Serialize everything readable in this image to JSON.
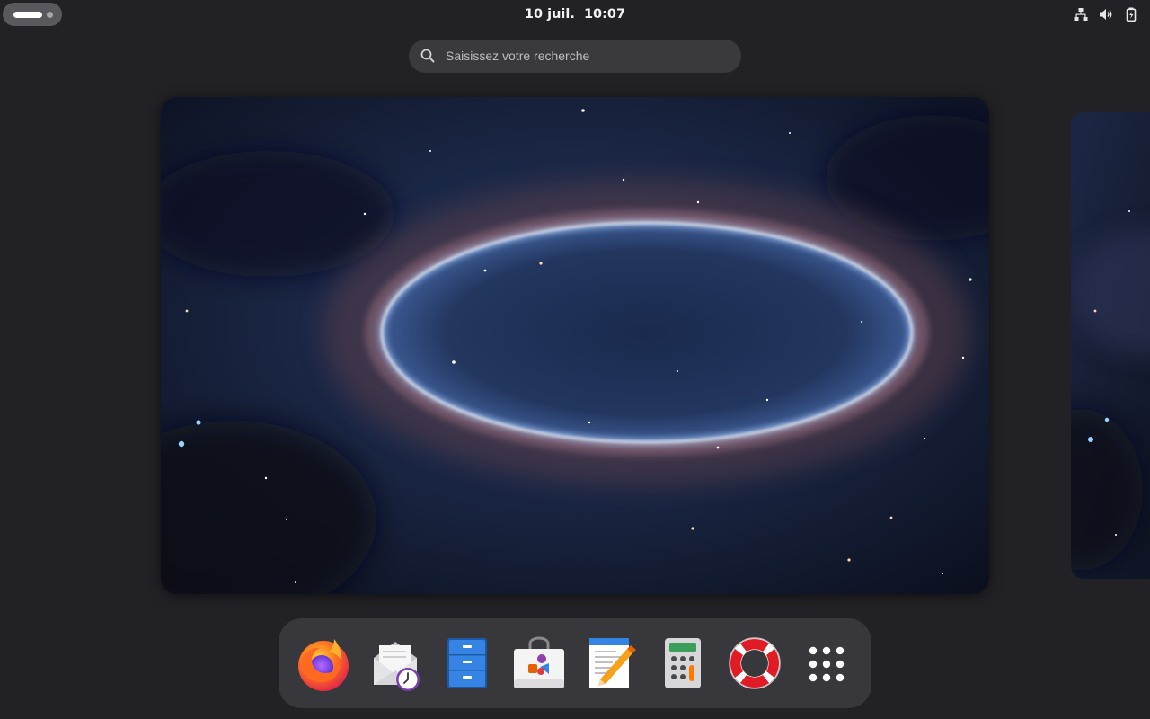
{
  "topbar": {
    "clock": "10 juil.  10:07",
    "tray_icons": [
      "network-wired-icon",
      "volume-icon",
      "battery-charging-icon"
    ]
  },
  "search": {
    "placeholder": "Saisissez votre recherche",
    "icon": "search-icon"
  },
  "workspaces": {
    "current": "workspace-1",
    "count_visible": 2,
    "wallpaper": "space-ring-nebula"
  },
  "dash": {
    "apps": [
      {
        "name": "Firefox",
        "icon": "firefox-icon"
      },
      {
        "name": "Evolution",
        "icon": "mail-clock-icon"
      },
      {
        "name": "Fichiers",
        "icon": "file-cabinet-icon"
      },
      {
        "name": "Logiciels",
        "icon": "software-bag-icon"
      },
      {
        "name": "Éditeur de texte",
        "icon": "text-editor-icon"
      },
      {
        "name": "Calculatrice",
        "icon": "calculator-icon"
      },
      {
        "name": "Aide",
        "icon": "lifebuoy-icon"
      },
      {
        "name": "Afficher les applications",
        "icon": "app-grid-icon"
      }
    ]
  },
  "colors": {
    "background": "#222226",
    "search_bg": "#3a3a3e",
    "dash_bg": "#38383c",
    "firefox_orange": "#ff6a1f",
    "files_blue": "#3584e4",
    "lifebuoy_red": "#e01b24"
  }
}
